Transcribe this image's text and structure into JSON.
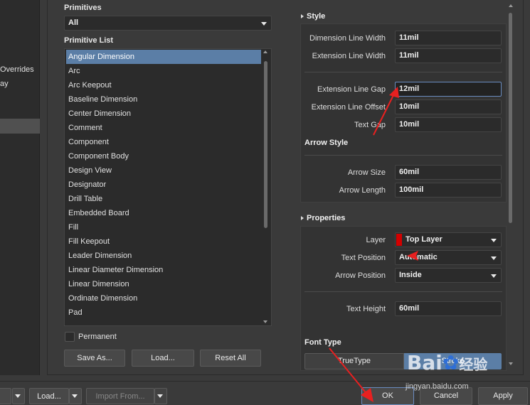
{
  "left_panel": {
    "items": [
      "Overrides",
      "ay"
    ]
  },
  "primitives": {
    "label": "Primitives",
    "selected": "All"
  },
  "primitive_list": {
    "label": "Primitive List",
    "items": [
      "Angular Dimension",
      "Arc",
      "Arc Keepout",
      "Baseline Dimension",
      "Center Dimension",
      "Comment",
      "Component",
      "Component Body",
      "Design View",
      "Designator",
      "Drill Table",
      "Embedded Board",
      "Fill",
      "Fill Keepout",
      "Leader Dimension",
      "Linear Diameter Dimension",
      "Linear Dimension",
      "Ordinate Dimension",
      "Pad"
    ],
    "selected_index": 0
  },
  "permanent": {
    "label": "Permanent",
    "checked": false
  },
  "buttons_left": {
    "save_as": "Save As...",
    "load": "Load...",
    "reset_all": "Reset All"
  },
  "style_section": {
    "title": "Style",
    "dimension_line_width": {
      "label": "Dimension Line Width",
      "value": "11mil"
    },
    "extension_line_width": {
      "label": "Extension Line Width",
      "value": "11mil"
    },
    "extension_line_gap": {
      "label": "Extension Line Gap",
      "value": "12mil"
    },
    "extension_line_offset": {
      "label": "Extension Line Offset",
      "value": "10mil"
    },
    "text_gap": {
      "label": "Text Gap",
      "value": "10mil"
    },
    "arrow_style_title": "Arrow Style",
    "arrow_size": {
      "label": "Arrow Size",
      "value": "60mil"
    },
    "arrow_length": {
      "label": "Arrow Length",
      "value": "100mil"
    }
  },
  "properties_section": {
    "title": "Properties",
    "layer": {
      "label": "Layer",
      "value": "Top Layer",
      "color": "#d40000"
    },
    "text_position": {
      "label": "Text Position",
      "value": "Automatic"
    },
    "arrow_position": {
      "label": "Arrow Position",
      "value": "Inside"
    },
    "text_height": {
      "label": "Text Height",
      "value": "60mil"
    },
    "font_type_title": "Font Type",
    "font_type_options": [
      "TrueType",
      "Stroke"
    ],
    "font_type_selected": "Stroke"
  },
  "bottom_bar": {
    "load": "Load...",
    "import_from": "Import From...",
    "ok": "OK",
    "cancel": "Cancel",
    "apply": "Apply"
  },
  "watermark": {
    "text_1": "Bai",
    "text_2": "经验",
    "url": "jingyan.baidu.com"
  },
  "colors": {
    "selection": "#5b7ea6",
    "annotation_arrow": "#e82020",
    "layer_swatch": "#d40000"
  }
}
